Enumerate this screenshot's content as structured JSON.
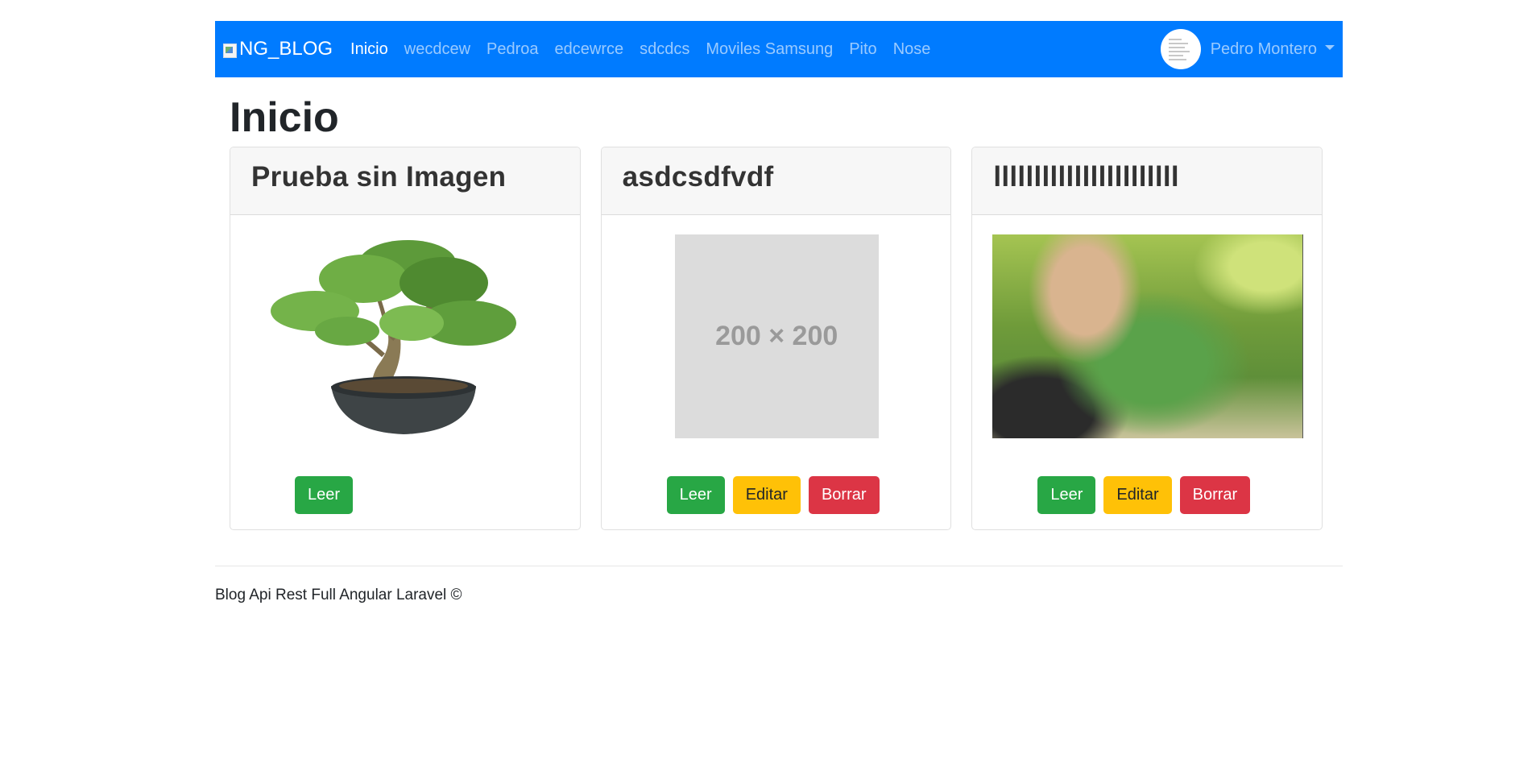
{
  "navbar": {
    "brand": "NG_BLOG",
    "links": [
      "Inicio",
      "wecdcew",
      "Pedroa",
      "edcewrce",
      "sdcdcs",
      "Moviles Samsung",
      "Pito",
      "Nose"
    ],
    "active": "Inicio",
    "user_name": "Pedro Montero",
    "accent_color": "#007bff"
  },
  "page_title": "Inicio",
  "posts": [
    {
      "title": "Prueba sin Imagen",
      "image": "bonsai-tree",
      "buttons": [
        "Leer"
      ]
    },
    {
      "title": "asdcsdfvdf",
      "image": "placeholder",
      "image_text": "200 × 200",
      "buttons": [
        "Leer",
        "Editar",
        "Borrar"
      ]
    },
    {
      "title": "lllllllllllllllllllllll",
      "image": "leaf-photo",
      "buttons": [
        "Leer",
        "Editar",
        "Borrar"
      ]
    }
  ],
  "footer": "Blog Api Rest Full Angular Laravel ©"
}
